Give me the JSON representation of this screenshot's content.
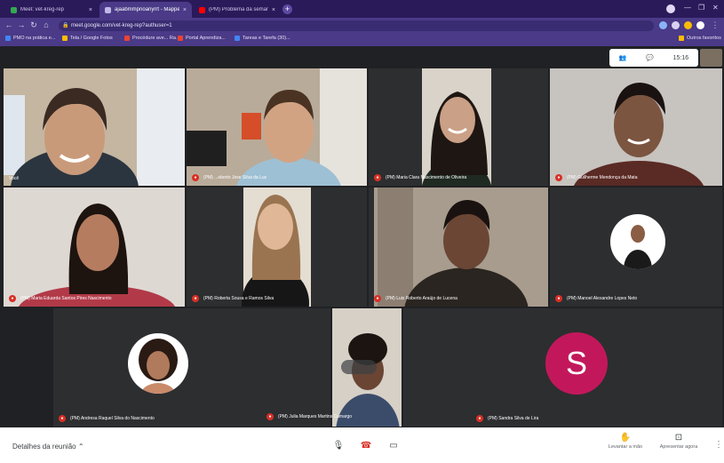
{
  "browser": {
    "tabs": [
      {
        "label": "Meet: vet-kreg-rep",
        "favicon_color": "#34a853",
        "active": false
      },
      {
        "label": "ajaabmmpnoanyrrt - Mapper",
        "favicon_color": "#c2b8e8",
        "active": true
      },
      {
        "label": "(PM) Problema da semana - Yo",
        "favicon_color": "#ff0000",
        "active": false
      }
    ],
    "address": "meet.google.com/vet-kreg-rep?authuser=1",
    "bookmarks": [
      {
        "label": "PMO na prática e...",
        "color": "#4285f4"
      },
      {
        "label": "Tela / Google Fotos",
        "color": "#fbbc04"
      },
      {
        "label": "Procédure ave... Ra...",
        "color": "#ea4335"
      },
      {
        "label": "Portal Aprendiza...",
        "color": "#ea4335"
      },
      {
        "label": "Tareas e Tarefa (30)...",
        "color": "#4285f4"
      },
      {
        "label": "Outros favoritos",
        "color": "#fbbc04"
      }
    ]
  },
  "meet": {
    "time": "15:16",
    "participants": [
      {
        "name": "Você",
        "speaking": true
      },
      {
        "name": "(PM) ...oberto Jose Silva da Luz",
        "speaking": false
      },
      {
        "name": "(PM) Maria Clara Nascimento de Oliveira",
        "speaking": false
      },
      {
        "name": "(PM) Guilherme Mendonça da Mata",
        "speaking": false
      },
      {
        "name": "(PM) Maria Eduarda Santos Pires Nascimento",
        "speaking": false
      },
      {
        "name": "(PM) Roberta Sousa e Ramos Silva",
        "speaking": false
      },
      {
        "name": "(PM) Luis Roberto Araújo de Lucena",
        "speaking": false
      },
      {
        "name": "(PM) Manoel Alexandre Lopes Neto",
        "speaking": false
      },
      {
        "name": "(PM) Andresa Raquel Silva do Nascimento",
        "speaking": false
      },
      {
        "name": "(PM) Julia Marques Martins Camargo",
        "speaking": false
      },
      {
        "name": "(PM) Sandra Silva de Lira",
        "speaking": false
      }
    ],
    "avatar_initial": "S",
    "avatar_color": "#c2185b",
    "bottom": {
      "details_label": "Detalhes da reunião",
      "raise_hand_label": "Levantar a mão",
      "present_label": "Apresentar agora"
    }
  }
}
